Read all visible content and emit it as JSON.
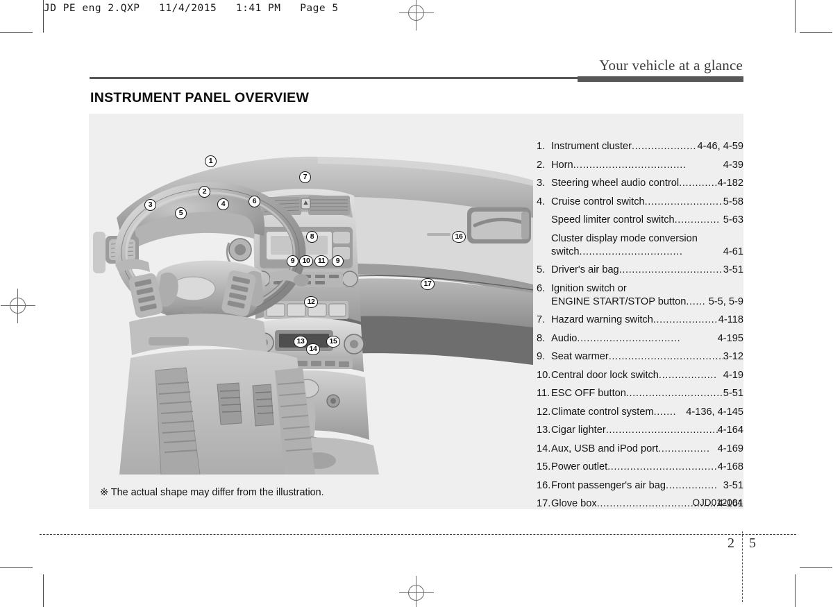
{
  "slug": "JD PE eng 2.QXP   11/4/2015   1:41 PM   Page 5",
  "running_head": "Your vehicle at a glance",
  "section_title": "INSTRUMENT PANEL OVERVIEW",
  "footnote": "※ The actual shape may differ from the illustration.",
  "figure_code": "OJD012004",
  "folio": {
    "chapter": "2",
    "page": "5"
  },
  "illustration": {
    "alt": "Instrument panel overview illustration",
    "callouts": [
      {
        "id": "1",
        "label": "1"
      },
      {
        "id": "2",
        "label": "2"
      },
      {
        "id": "3",
        "label": "3"
      },
      {
        "id": "4",
        "label": "4"
      },
      {
        "id": "5",
        "label": "5"
      },
      {
        "id": "6",
        "label": "6"
      },
      {
        "id": "7",
        "label": "7"
      },
      {
        "id": "8",
        "label": "8"
      },
      {
        "id": "9a",
        "label": "9"
      },
      {
        "id": "10",
        "label": "10"
      },
      {
        "id": "11",
        "label": "11"
      },
      {
        "id": "9b",
        "label": "9"
      },
      {
        "id": "12",
        "label": "12"
      },
      {
        "id": "13",
        "label": "13"
      },
      {
        "id": "14",
        "label": "14"
      },
      {
        "id": "15",
        "label": "15"
      },
      {
        "id": "16",
        "label": "16"
      },
      {
        "id": "17",
        "label": "17"
      }
    ]
  },
  "index": {
    "rows": [
      {
        "num": "1.",
        "label": "Instrument cluster",
        "dots": "......................",
        "page": "4-46, 4-59"
      },
      {
        "num": "2.",
        "label": "Horn",
        "dots": "...................................",
        "page": "4-39"
      },
      {
        "num": "3.",
        "label": "Steering wheel audio control",
        "dots": "............",
        "page": "4-182"
      },
      {
        "num": "4.",
        "label": "Cruise control switch",
        "dots": "..........................",
        "page": "5-58"
      },
      {
        "num": "",
        "label": "Speed limiter control switch",
        "dots": "..............",
        "page": "5-63",
        "cont": true
      },
      {
        "num": "",
        "label": "Cluster display mode conversion",
        "dots": "",
        "page": "",
        "cont": true,
        "nodots": true,
        "tight": true
      },
      {
        "num": "",
        "label": "switch",
        "dots": "................................",
        "page": "4-61",
        "cont": true
      },
      {
        "num": "5.",
        "label": "Driver's air bag",
        "dots": "..................................",
        "page": "3-51"
      },
      {
        "num": "6.",
        "label": "Ignition switch or",
        "dots": "",
        "page": "",
        "nodots": true,
        "tight": true
      },
      {
        "num": "",
        "label": "ENGINE START/STOP button",
        "dots": "......",
        "page": "5-5, 5-9",
        "cont": true
      },
      {
        "num": "7.",
        "label": "Hazard warning switch",
        "dots": "......................",
        "page": "4-118"
      },
      {
        "num": "8.",
        "label": "Audio",
        "dots": "................................",
        "page": "4-195"
      },
      {
        "num": "9.",
        "label": "Seat warmer",
        "dots": "........................................",
        "page": "3-12"
      },
      {
        "num": "10.",
        "label": "Central door lock switch",
        "dots": "..................",
        "page": "4-19"
      },
      {
        "num": "11.",
        "label": "ESC OFF button",
        "dots": "..............................",
        "page": "5-51"
      },
      {
        "num": "12.",
        "label": "Climate control system",
        "dots": ".......",
        "page": "4-136, 4-145"
      },
      {
        "num": "13.",
        "label": "Cigar lighter",
        "dots": "....................................",
        "page": "4-164"
      },
      {
        "num": "14.",
        "label": "Aux, USB and iPod port",
        "dots": "................",
        "page": "4-169"
      },
      {
        "num": "15.",
        "label": "Power outlet",
        "dots": "...................................",
        "page": "4-168"
      },
      {
        "num": "16.",
        "label": "Front passenger's air bag",
        "dots": "................",
        "page": "3-51"
      },
      {
        "num": "17.",
        "label": "Glove box",
        "dots": ".......................................",
        "page": "4-161"
      }
    ]
  },
  "colors": {
    "rule": "#575757",
    "panel_bg": "#efefef",
    "text": "#141414"
  }
}
